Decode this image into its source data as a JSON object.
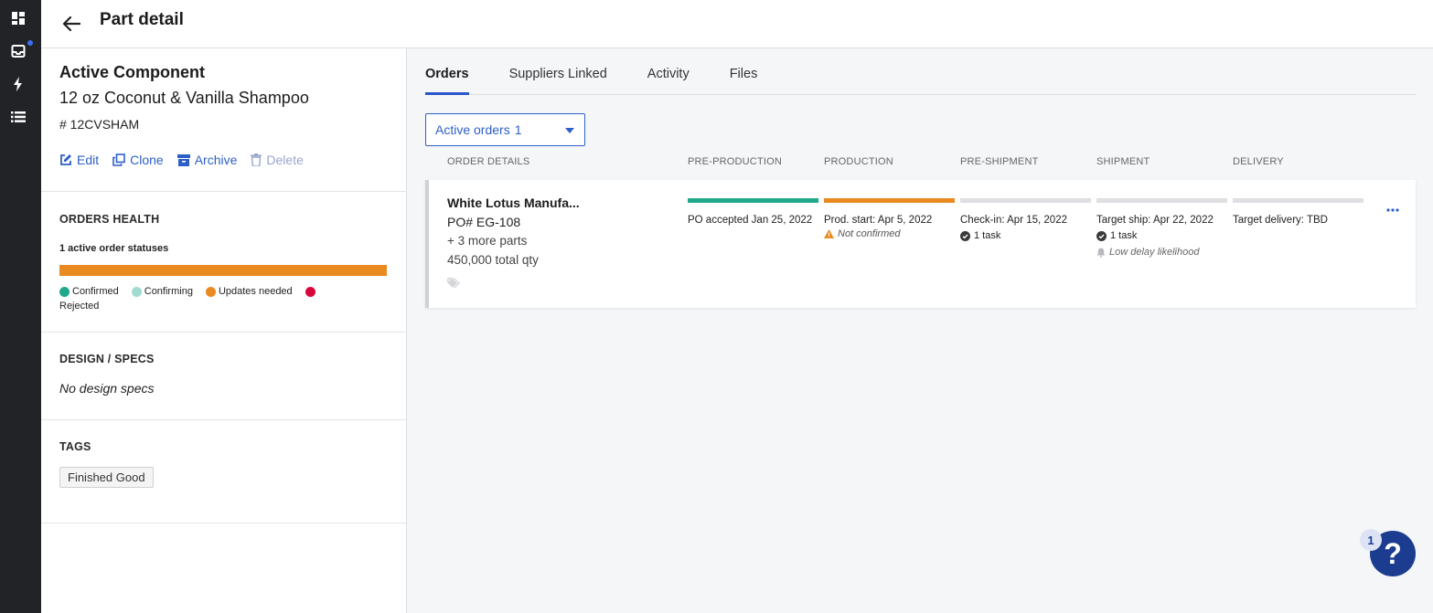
{
  "header": {
    "title": "Part detail"
  },
  "component": {
    "heading": "Active Component",
    "name": "12 oz Coconut & Vanilla Shampoo",
    "sku": "# 12CVSHAM",
    "actions": {
      "edit": "Edit",
      "clone": "Clone",
      "archive": "Archive",
      "delete": "Delete"
    }
  },
  "orders_health": {
    "label": "ORDERS HEALTH",
    "subtitle": "1 active order statuses",
    "bar_fill": {
      "updates_needed": 1.0
    },
    "legend": [
      {
        "label": "Confirmed",
        "color": "#1fa88c"
      },
      {
        "label": "Confirming",
        "color": "#9fdccf"
      },
      {
        "label": "Updates needed",
        "color": "#e98a21"
      },
      {
        "label": "Rejected",
        "color": "#d9083c"
      }
    ]
  },
  "design": {
    "label": "DESIGN / SPECS",
    "empty": "No design specs"
  },
  "tags": {
    "label": "TAGS",
    "items": [
      "Finished Good"
    ]
  },
  "tabs": [
    {
      "label": "Orders",
      "active": true
    },
    {
      "label": "Suppliers Linked",
      "active": false
    },
    {
      "label": "Activity",
      "active": false
    },
    {
      "label": "Files",
      "active": false
    }
  ],
  "filter": {
    "label": "Active orders",
    "count": "1"
  },
  "columns": [
    "ORDER DETAILS",
    "PRE-PRODUCTION",
    "PRODUCTION",
    "PRE-SHIPMENT",
    "SHIPMENT",
    "DELIVERY"
  ],
  "order": {
    "supplier": "White Lotus Manufa...",
    "po": "PO# EG-108",
    "more_parts": "+ 3 more parts",
    "total_qty": "450,000 total qty",
    "stages": {
      "pre_production": {
        "text": "PO accepted Jan 25, 2022",
        "color": "#1fa88c"
      },
      "production": {
        "text": "Prod. start: Apr 5, 2022",
        "warning": "Not confirmed",
        "color": "#e98a21"
      },
      "pre_shipment": {
        "text": "Check-in: Apr 15, 2022",
        "task": "1 task",
        "color": "#dedfe2"
      },
      "shipment": {
        "text": "Target ship: Apr 22, 2022",
        "task": "1 task",
        "note": "Low delay likelihood",
        "color": "#dedfe2"
      },
      "delivery": {
        "text": "Target delivery: TBD",
        "color": "#dedfe2"
      }
    }
  },
  "help": {
    "symbol": "?",
    "badge": "1"
  }
}
